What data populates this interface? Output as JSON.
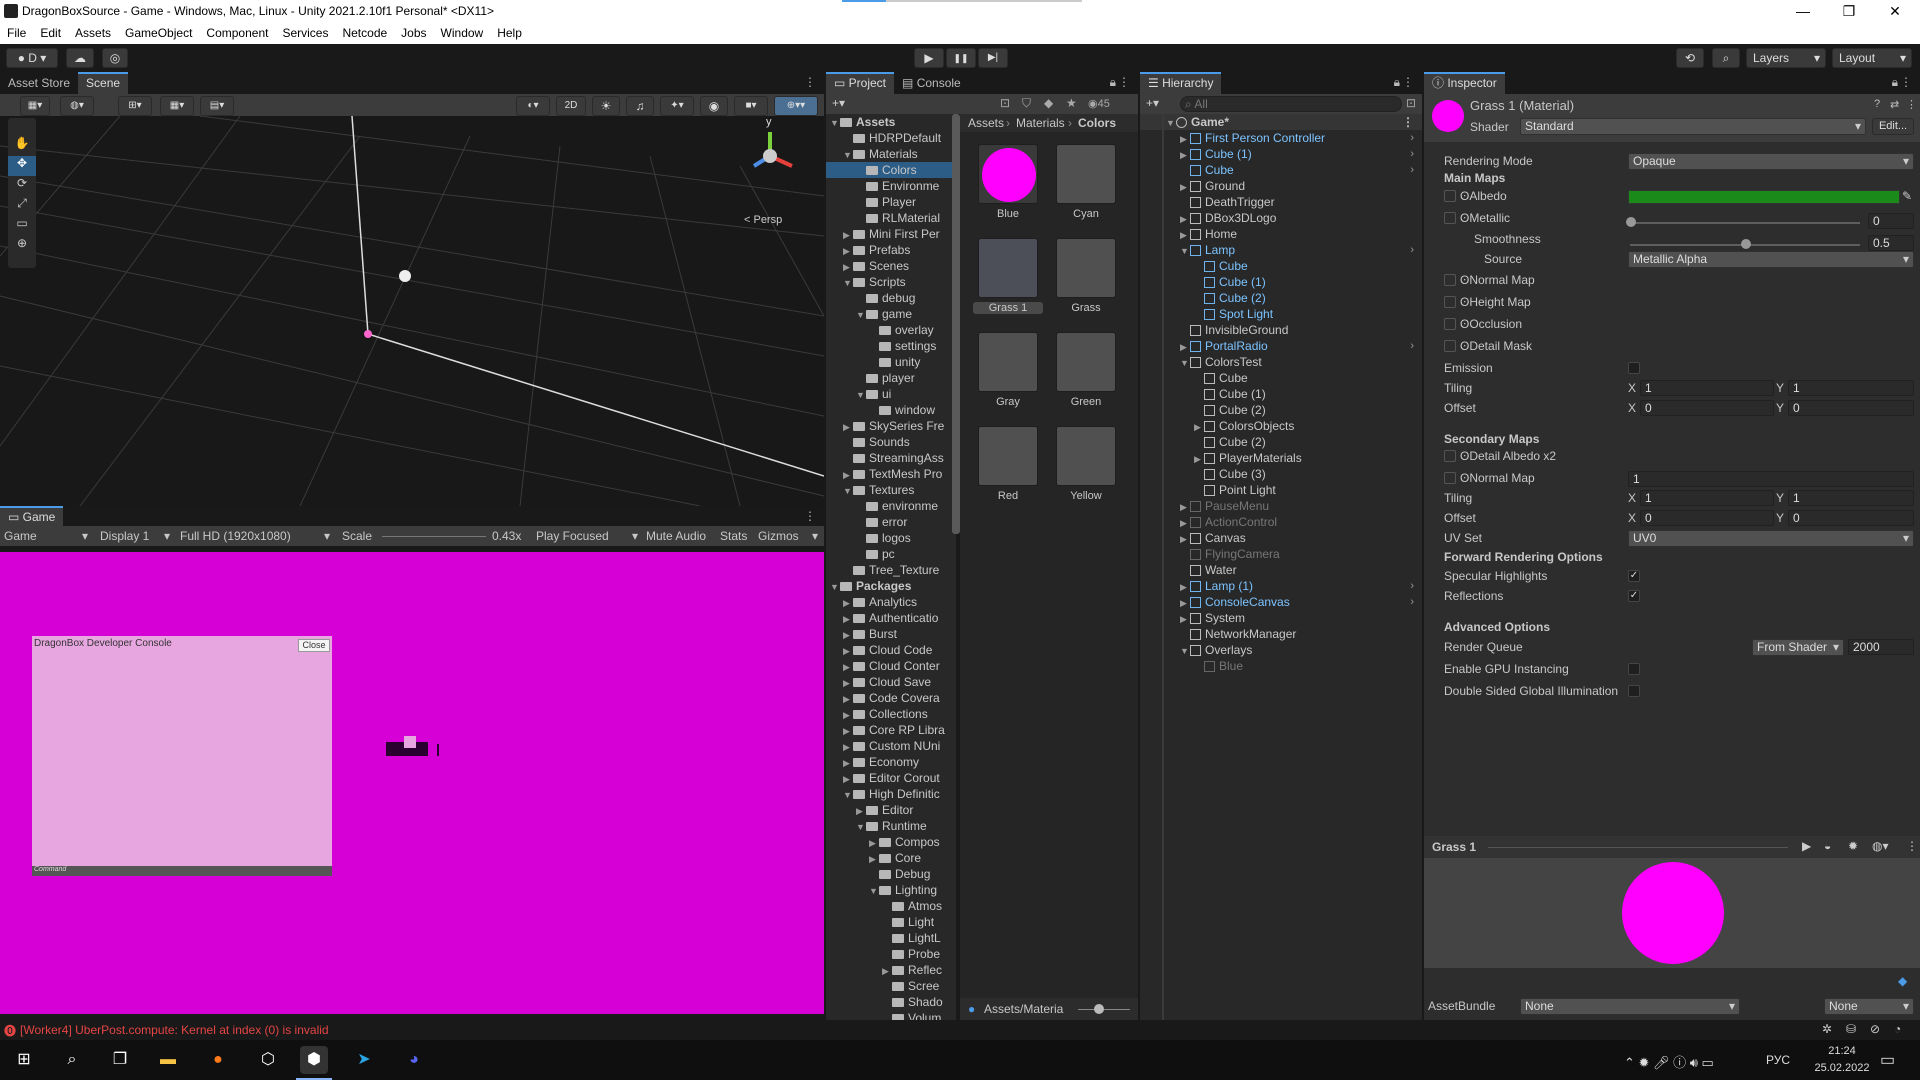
{
  "window": {
    "title": "DragonBoxSource - Game - Windows, Mac, Linux - Unity 2021.2.10f1 Personal* <DX11>",
    "minimize": "—",
    "maximize": "❐",
    "close": "✕"
  },
  "menu": [
    "File",
    "Edit",
    "Assets",
    "GameObject",
    "Component",
    "Services",
    "Netcode",
    "Jobs",
    "Window",
    "Help"
  ],
  "toolbar": {
    "account": "D",
    "play": "▶",
    "pause": "❚❚",
    "step": "▶|",
    "layers": "Layers",
    "layout": "Layout"
  },
  "scene": {
    "tabs": [
      "Asset Store",
      "Scene"
    ],
    "btn2d": "2D",
    "persp": "< Persp",
    "gizmo_y": "y"
  },
  "game": {
    "tab": "Game",
    "view": "Game",
    "display": "Display 1",
    "resolution": "Full HD (1920x1080)",
    "scale_label": "Scale",
    "scale_value": "0.43x",
    "play_focused": "Play Focused",
    "mute": "Mute Audio",
    "stats": "Stats",
    "gizmos": "Gizmos",
    "console_title": "DragonBox Developer Console",
    "console_close": "Close",
    "console_command": "Command",
    "bg_color": "#d600d6"
  },
  "project": {
    "tabs": [
      "Project",
      "Console"
    ],
    "count": "45",
    "breadcrumb": [
      "Assets",
      "Materials",
      "Colors"
    ],
    "status_path": "Assets/Materia",
    "tree": [
      {
        "t": "Assets",
        "lvl": 0,
        "arrow": "▼",
        "bold": true
      },
      {
        "t": "HDRPDefault",
        "lvl": 1,
        "arrow": ""
      },
      {
        "t": "Materials",
        "lvl": 1,
        "arrow": "▼"
      },
      {
        "t": "Colors",
        "lvl": 2,
        "arrow": "",
        "sel": true
      },
      {
        "t": "Environme",
        "lvl": 2,
        "arrow": ""
      },
      {
        "t": "Player",
        "lvl": 2,
        "arrow": ""
      },
      {
        "t": "RLMaterial",
        "lvl": 2,
        "arrow": ""
      },
      {
        "t": "Mini First Per",
        "lvl": 1,
        "arrow": "▶"
      },
      {
        "t": "Prefabs",
        "lvl": 1,
        "arrow": "▶"
      },
      {
        "t": "Scenes",
        "lvl": 1,
        "arrow": "▶"
      },
      {
        "t": "Scripts",
        "lvl": 1,
        "arrow": "▼"
      },
      {
        "t": "debug",
        "lvl": 2,
        "arrow": ""
      },
      {
        "t": "game",
        "lvl": 2,
        "arrow": "▼"
      },
      {
        "t": "overlay",
        "lvl": 3,
        "arrow": ""
      },
      {
        "t": "settings",
        "lvl": 3,
        "arrow": ""
      },
      {
        "t": "unity",
        "lvl": 3,
        "arrow": ""
      },
      {
        "t": "player",
        "lvl": 2,
        "arrow": ""
      },
      {
        "t": "ui",
        "lvl": 2,
        "arrow": "▼"
      },
      {
        "t": "window",
        "lvl": 3,
        "arrow": ""
      },
      {
        "t": "SkySeries Fre",
        "lvl": 1,
        "arrow": "▶"
      },
      {
        "t": "Sounds",
        "lvl": 1,
        "arrow": ""
      },
      {
        "t": "StreamingAss",
        "lvl": 1,
        "arrow": ""
      },
      {
        "t": "TextMesh Pro",
        "lvl": 1,
        "arrow": "▶"
      },
      {
        "t": "Textures",
        "lvl": 1,
        "arrow": "▼"
      },
      {
        "t": "environme",
        "lvl": 2,
        "arrow": ""
      },
      {
        "t": "error",
        "lvl": 2,
        "arrow": ""
      },
      {
        "t": "logos",
        "lvl": 2,
        "arrow": ""
      },
      {
        "t": "pc",
        "lvl": 2,
        "arrow": ""
      },
      {
        "t": "Tree_Texture",
        "lvl": 1,
        "arrow": ""
      },
      {
        "t": "Packages",
        "lvl": 0,
        "arrow": "▼",
        "bold": true
      },
      {
        "t": "Analytics",
        "lvl": 1,
        "arrow": "▶"
      },
      {
        "t": "Authenticatio",
        "lvl": 1,
        "arrow": "▶"
      },
      {
        "t": "Burst",
        "lvl": 1,
        "arrow": "▶"
      },
      {
        "t": "Cloud Code",
        "lvl": 1,
        "arrow": "▶"
      },
      {
        "t": "Cloud Conter",
        "lvl": 1,
        "arrow": "▶"
      },
      {
        "t": "Cloud Save",
        "lvl": 1,
        "arrow": "▶"
      },
      {
        "t": "Code Covera",
        "lvl": 1,
        "arrow": "▶"
      },
      {
        "t": "Collections",
        "lvl": 1,
        "arrow": "▶"
      },
      {
        "t": "Core RP Libra",
        "lvl": 1,
        "arrow": "▶"
      },
      {
        "t": "Custom NUni",
        "lvl": 1,
        "arrow": "▶"
      },
      {
        "t": "Economy",
        "lvl": 1,
        "arrow": "▶"
      },
      {
        "t": "Editor Corout",
        "lvl": 1,
        "arrow": "▶"
      },
      {
        "t": "High Definitic",
        "lvl": 1,
        "arrow": "▼"
      },
      {
        "t": "Editor",
        "lvl": 2,
        "arrow": "▶"
      },
      {
        "t": "Runtime",
        "lvl": 2,
        "arrow": "▼"
      },
      {
        "t": "Compos",
        "lvl": 3,
        "arrow": "▶"
      },
      {
        "t": "Core",
        "lvl": 3,
        "arrow": "▶"
      },
      {
        "t": "Debug",
        "lvl": 3,
        "arrow": ""
      },
      {
        "t": "Lighting",
        "lvl": 3,
        "arrow": "▼"
      },
      {
        "t": "Atmos",
        "lvl": 4,
        "arrow": ""
      },
      {
        "t": "Light",
        "lvl": 4,
        "arrow": ""
      },
      {
        "t": "LightL",
        "lvl": 4,
        "arrow": ""
      },
      {
        "t": "Probe",
        "lvl": 4,
        "arrow": ""
      },
      {
        "t": "Reflec",
        "lvl": 4,
        "arrow": "▶"
      },
      {
        "t": "Scree",
        "lvl": 4,
        "arrow": ""
      },
      {
        "t": "Shado",
        "lvl": 4,
        "arrow": ""
      },
      {
        "t": "Volum",
        "lvl": 4,
        "arrow": ""
      }
    ],
    "assets": [
      {
        "name": "Blue",
        "color": "#ff00ff",
        "sphere": true
      },
      {
        "name": "Cyan",
        "color": "#505050"
      },
      {
        "name": "Grass 1",
        "color": "#4c4f57",
        "sel": true
      },
      {
        "name": "Grass",
        "color": "#505050"
      },
      {
        "name": "Gray",
        "color": "#505050"
      },
      {
        "name": "Green",
        "color": "#505050"
      },
      {
        "name": "Red",
        "color": "#505050"
      },
      {
        "name": "Yellow",
        "color": "#505050"
      }
    ]
  },
  "hierarchy": {
    "tab": "Hierarchy",
    "search_placeholder": "All",
    "items": [
      {
        "t": "Game*",
        "lvl": 0,
        "arrow": "▼",
        "kind": "scene"
      },
      {
        "t": "First Person Controller",
        "lvl": 1,
        "arrow": "▶",
        "kind": "blue",
        "more": true
      },
      {
        "t": "Cube (1)",
        "lvl": 1,
        "arrow": "▶",
        "kind": "blue",
        "more": true
      },
      {
        "t": "Cube",
        "lvl": 1,
        "arrow": "",
        "kind": "blue",
        "more": true
      },
      {
        "t": "Ground",
        "lvl": 1,
        "arrow": "▶",
        "kind": "n"
      },
      {
        "t": "DeathTrigger",
        "lvl": 1,
        "arrow": "",
        "kind": "n"
      },
      {
        "t": "DBox3DLogo",
        "lvl": 1,
        "arrow": "▶",
        "kind": "n"
      },
      {
        "t": "Home",
        "lvl": 1,
        "arrow": "▶",
        "kind": "n"
      },
      {
        "t": "Lamp",
        "lvl": 1,
        "arrow": "▼",
        "kind": "blue",
        "more": true
      },
      {
        "t": "Cube",
        "lvl": 2,
        "arrow": "",
        "kind": "blue"
      },
      {
        "t": "Cube (1)",
        "lvl": 2,
        "arrow": "",
        "kind": "blue"
      },
      {
        "t": "Cube (2)",
        "lvl": 2,
        "arrow": "",
        "kind": "blue"
      },
      {
        "t": "Spot Light",
        "lvl": 2,
        "arrow": "",
        "kind": "blue"
      },
      {
        "t": "InvisibleGround",
        "lvl": 1,
        "arrow": "",
        "kind": "n"
      },
      {
        "t": "PortalRadio",
        "lvl": 1,
        "arrow": "▶",
        "kind": "blue",
        "more": true
      },
      {
        "t": "ColorsTest",
        "lvl": 1,
        "arrow": "▼",
        "kind": "n"
      },
      {
        "t": "Cube",
        "lvl": 2,
        "arrow": "",
        "kind": "n"
      },
      {
        "t": "Cube (1)",
        "lvl": 2,
        "arrow": "",
        "kind": "n"
      },
      {
        "t": "Cube (2)",
        "lvl": 2,
        "arrow": "",
        "kind": "n"
      },
      {
        "t": "ColorsObjects",
        "lvl": 2,
        "arrow": "▶",
        "kind": "n"
      },
      {
        "t": "Cube (2)",
        "lvl": 2,
        "arrow": "",
        "kind": "n"
      },
      {
        "t": "PlayerMaterials",
        "lvl": 2,
        "arrow": "▶",
        "kind": "n"
      },
      {
        "t": "Cube (3)",
        "lvl": 2,
        "arrow": "",
        "kind": "n"
      },
      {
        "t": "Point Light",
        "lvl": 2,
        "arrow": "",
        "kind": "n"
      },
      {
        "t": "PauseMenu",
        "lvl": 1,
        "arrow": "▶",
        "kind": "dim"
      },
      {
        "t": "ActionControl",
        "lvl": 1,
        "arrow": "▶",
        "kind": "dim"
      },
      {
        "t": "Canvas",
        "lvl": 1,
        "arrow": "▶",
        "kind": "n"
      },
      {
        "t": "FlyingCamera",
        "lvl": 1,
        "arrow": "",
        "kind": "dim"
      },
      {
        "t": "Water",
        "lvl": 1,
        "arrow": "",
        "kind": "n"
      },
      {
        "t": "Lamp (1)",
        "lvl": 1,
        "arrow": "▶",
        "kind": "blue",
        "more": true
      },
      {
        "t": "ConsoleCanvas",
        "lvl": 1,
        "arrow": "▶",
        "kind": "blue",
        "more": true
      },
      {
        "t": "System",
        "lvl": 1,
        "arrow": "▶",
        "kind": "n"
      },
      {
        "t": "NetworkManager",
        "lvl": 1,
        "arrow": "",
        "kind": "n"
      },
      {
        "t": "Overlays",
        "lvl": 1,
        "arrow": "▼",
        "kind": "n"
      },
      {
        "t": "Blue",
        "lvl": 2,
        "arrow": "",
        "kind": "dim"
      }
    ]
  },
  "inspector": {
    "tab": "Inspector",
    "material_name": "Grass 1 (Material)",
    "shader_label": "Shader",
    "shader_value": "Standard",
    "edit": "Edit...",
    "rendering_mode_label": "Rendering Mode",
    "rendering_mode": "Opaque",
    "main_maps": "Main Maps",
    "albedo": "Albedo",
    "albedo_color": "#1a8a1a",
    "metallic": "Metallic",
    "metallic_value": "0",
    "metallic_level": 0,
    "smoothness": "Smoothness",
    "smoothness_value": "0.5",
    "smoothness_level": 0.5,
    "source": "Source",
    "source_value": "Metallic Alpha",
    "normal_map": "Normal Map",
    "height_map": "Height Map",
    "occlusion": "Occlusion",
    "detail_mask": "Detail Mask",
    "emission": "Emission",
    "tiling": "Tiling",
    "offset": "Offset",
    "tiling_x": "1",
    "tiling_y": "1",
    "offset_x": "0",
    "offset_y": "0",
    "xl": "X",
    "yl": "Y",
    "secondary_maps": "Secondary Maps",
    "detail_albedo": "Detail Albedo x2",
    "normal_map2": "Normal Map",
    "normal_map2_value": "1",
    "tiling2_x": "1",
    "tiling2_y": "1",
    "offset2_x": "0",
    "offset2_y": "0",
    "uv_set": "UV Set",
    "uv_value": "UV0",
    "forward": "Forward Rendering Options",
    "specular": "Specular Highlights",
    "reflections": "Reflections",
    "check": "✓",
    "advanced": "Advanced Options",
    "render_queue": "Render Queue",
    "render_queue_mode": "From Shader",
    "render_queue_value": "2000",
    "gpu_instancing": "Enable GPU Instancing",
    "double_sided": "Double Sided Global Illumination",
    "preview_name": "Grass 1",
    "assetbundle": "AssetBundle",
    "ab_value": "None",
    "ab_variant": "None",
    "preview_color": "#ff00ff"
  },
  "status": {
    "error": "[Worker4] UberPost.compute: Kernel at index (0) is invalid"
  },
  "taskbar": {
    "lang": "РУС",
    "time": "21:24",
    "date": "25.02.2022"
  }
}
